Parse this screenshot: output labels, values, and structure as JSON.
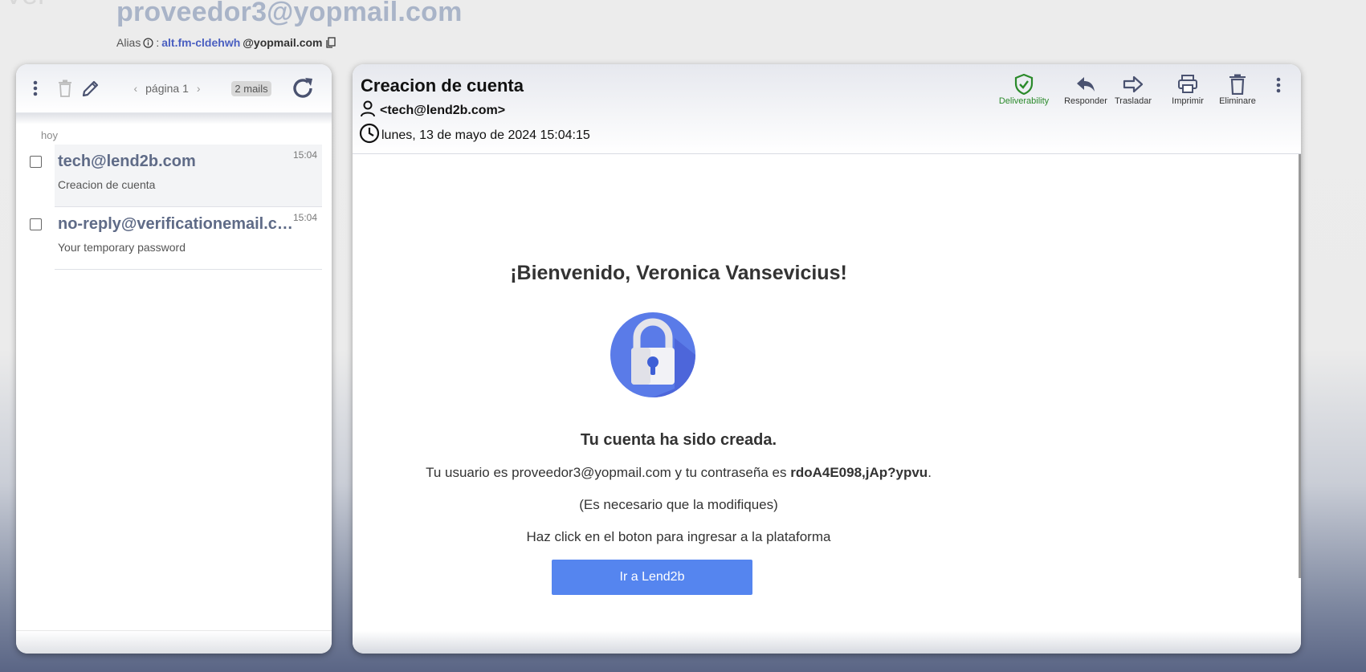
{
  "header": {
    "title_fragment": "Ver",
    "mailbox": "proveedor3@yopmail.com",
    "alias_label": "Alias",
    "alias_sep": ":",
    "alias_name": "alt.fm-cldehwh",
    "alias_domain": "@yopmail.com"
  },
  "inbox": {
    "pager_label": "página 1",
    "count_badge": "2 mails",
    "day_label": "hoy",
    "mails": [
      {
        "from": "tech@lend2b.com",
        "subject": "Creacion de cuenta",
        "time": "15:04",
        "selected": true
      },
      {
        "from": "no-reply@verificationemail.com",
        "subject": "Your temporary password",
        "time": "15:04",
        "selected": false
      }
    ]
  },
  "message": {
    "subject": "Creacion de cuenta",
    "from": "<tech@lend2b.com>",
    "date": "lunes, 13 de mayo de 2024 15:04:15",
    "actions": {
      "deliverability": "Deliverability",
      "reply": "Responder",
      "forward": "Trasladar",
      "print": "Imprimir",
      "delete": "Eliminare"
    },
    "body": {
      "welcome": "¡Bienvenido, Veronica Vansevicius!",
      "created": "Tu cuenta ha sido creada.",
      "line1_prefix": "Tu usuario es proveedor3@yopmail.com y tu contraseña es ",
      "password": "rdoA4E098,jAp?ypvu",
      "line1_suffix": ".",
      "line2": "(Es necesario que la modifiques)",
      "line3": "Haz click en el boton para ingresar a la plataforma",
      "button": "Ir a Lend2b"
    }
  },
  "colors": {
    "accent": "#4a5fc1",
    "deliverability_green": "#2b8a2b",
    "button_blue": "#5585ef",
    "lock_circle": "#5a7be8"
  }
}
